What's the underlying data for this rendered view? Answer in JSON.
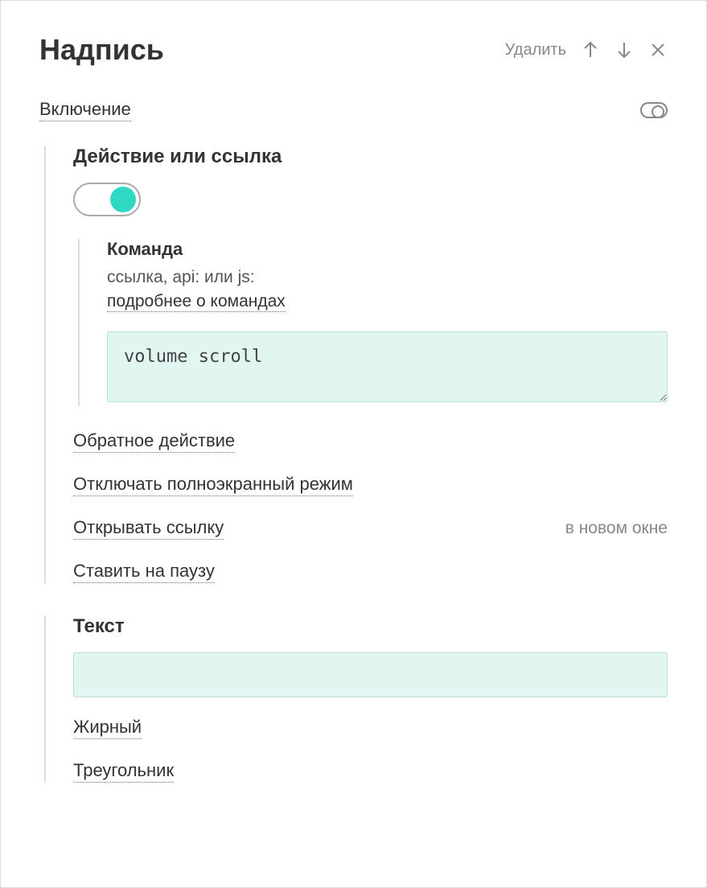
{
  "header": {
    "title": "Надпись",
    "delete": "Удалить"
  },
  "enable": {
    "label": "Включение"
  },
  "action": {
    "heading": "Действие или ссылка",
    "command": {
      "heading": "Команда",
      "hint": "ссылка, api: или js:",
      "more": "подробнее о командах",
      "value": "volume scroll"
    },
    "reverse": "Обратное действие",
    "disableFullscreen": "Отключать полноэкранный режим",
    "openLink": {
      "label": "Открывать ссылку",
      "value": "в новом окне"
    },
    "pause": "Ставить на паузу"
  },
  "text": {
    "heading": "Текст",
    "value": "",
    "bold": "Жирный",
    "triangle": "Треугольник"
  }
}
